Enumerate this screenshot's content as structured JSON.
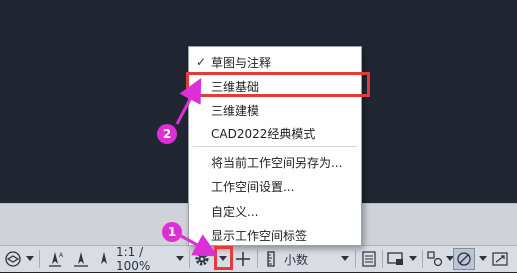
{
  "menu": {
    "items": [
      {
        "label": "草图与注释",
        "checked": true
      },
      {
        "label": "三维基础",
        "checked": false
      },
      {
        "label": "三维建模",
        "checked": false
      },
      {
        "label": "CAD2022经典模式",
        "checked": false
      },
      {
        "label": "将当前工作空间另存为...",
        "checked": false
      },
      {
        "label": "工作空间设置...",
        "checked": false
      },
      {
        "label": "自定义...",
        "checked": false
      },
      {
        "label": "显示工作空间标签",
        "checked": false
      }
    ],
    "check_glyph": "✓"
  },
  "status_bar": {
    "scale": "1:1 / 100%",
    "units": "小数"
  },
  "callouts": {
    "one": "1",
    "two": "2"
  },
  "colors": {
    "callout": "#dc2fd6",
    "highlight": "#e23b3b"
  }
}
